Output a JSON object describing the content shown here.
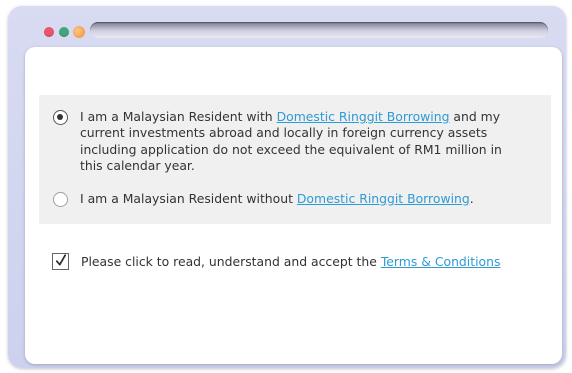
{
  "window": {
    "controls": [
      "close",
      "minimize",
      "maximize"
    ]
  },
  "options": [
    {
      "selected": true,
      "text_before": "I am a Malaysian Resident with ",
      "link_text": "Domestic Ringgit Borrowing",
      "text_after": " and my current investments abroad and locally in foreign currency assets including application do not exceed the equivalent of RM1 million in this calendar year."
    },
    {
      "selected": false,
      "text_before": "I am a Malaysian Resident without ",
      "link_text": "Domestic Ringgit Borrowing",
      "text_after": "."
    }
  ],
  "terms": {
    "checked": true,
    "text": "Please click to read, understand and accept the ",
    "link_text": "Terms & Conditions"
  },
  "colors": {
    "link": "#2e9bd3",
    "text": "#333333",
    "option_background": "#f0f0f0",
    "frame": "#d3d6f0"
  }
}
